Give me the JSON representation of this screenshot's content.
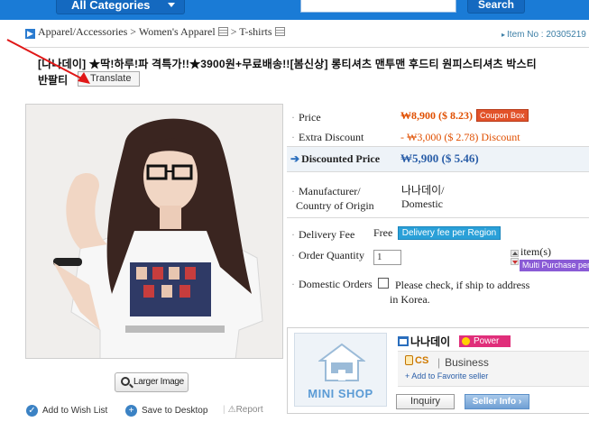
{
  "topbar": {
    "categories_label": "All Categories",
    "search_placeholder": "",
    "search_label": "Search"
  },
  "breadcrumb": {
    "path": "Apparel/Accessories > Women's Apparel",
    "sep": ">",
    "leaf": "T-shirts"
  },
  "item_no": {
    "label": "Item No :",
    "value": "20305219"
  },
  "product": {
    "title_line1": "[나나데이] ★딱!하루!파 격특가!!★3900원+무료배송!![봄신상] 롱티셔츠 맨투맨 후드티 원피스티셔츠 박스티",
    "title_line2": "반팔티",
    "translate_label": "Translate"
  },
  "image_actions": {
    "larger_image": "Larger Image",
    "wish_list": "Add to Wish List",
    "save_desktop": "Save to Desktop",
    "report": "Report"
  },
  "pricing": {
    "price_label": "Price",
    "price_value": "₩8,900 ($ 8.23)",
    "coupon_label": "Coupon Box",
    "extra_label": "Extra Discount",
    "extra_value": "- ₩3,000 ($ 2.78) Discount",
    "discounted_label": "Discounted Price",
    "discounted_value": "₩5,900 ($ 5.46)",
    "manufacturer_label_1": "Manufacturer/",
    "manufacturer_label_2": "Country of Origin",
    "manufacturer_value_1": "나나데이/",
    "manufacturer_value_2": "Domestic"
  },
  "order": {
    "delivery_label": "Delivery Fee",
    "delivery_value": "Free",
    "delivery_badge": "Delivery fee per Region",
    "quantity_label": "Order Quantity",
    "quantity_value": "1",
    "quantity_unit": "item(s)",
    "multi_purchase": "Multi Purchase per",
    "domestic_label": "Domestic Orders",
    "domestic_note_1": "Please check, if ship to address",
    "domestic_note_2": "in Korea."
  },
  "seller": {
    "minishop_label": "MINI SHOP",
    "name": "나나데이",
    "power_label": "Power",
    "cs_label": "CS",
    "business_label": "Business",
    "favorite_label": "Add to Favorite seller",
    "inquiry_label": "Inquiry",
    "seller_info_label": "Seller Info"
  },
  "colors": {
    "topbar": "#1a7bd6",
    "price_orange": "#e04f00",
    "discount_blue": "#2a5ea8"
  }
}
